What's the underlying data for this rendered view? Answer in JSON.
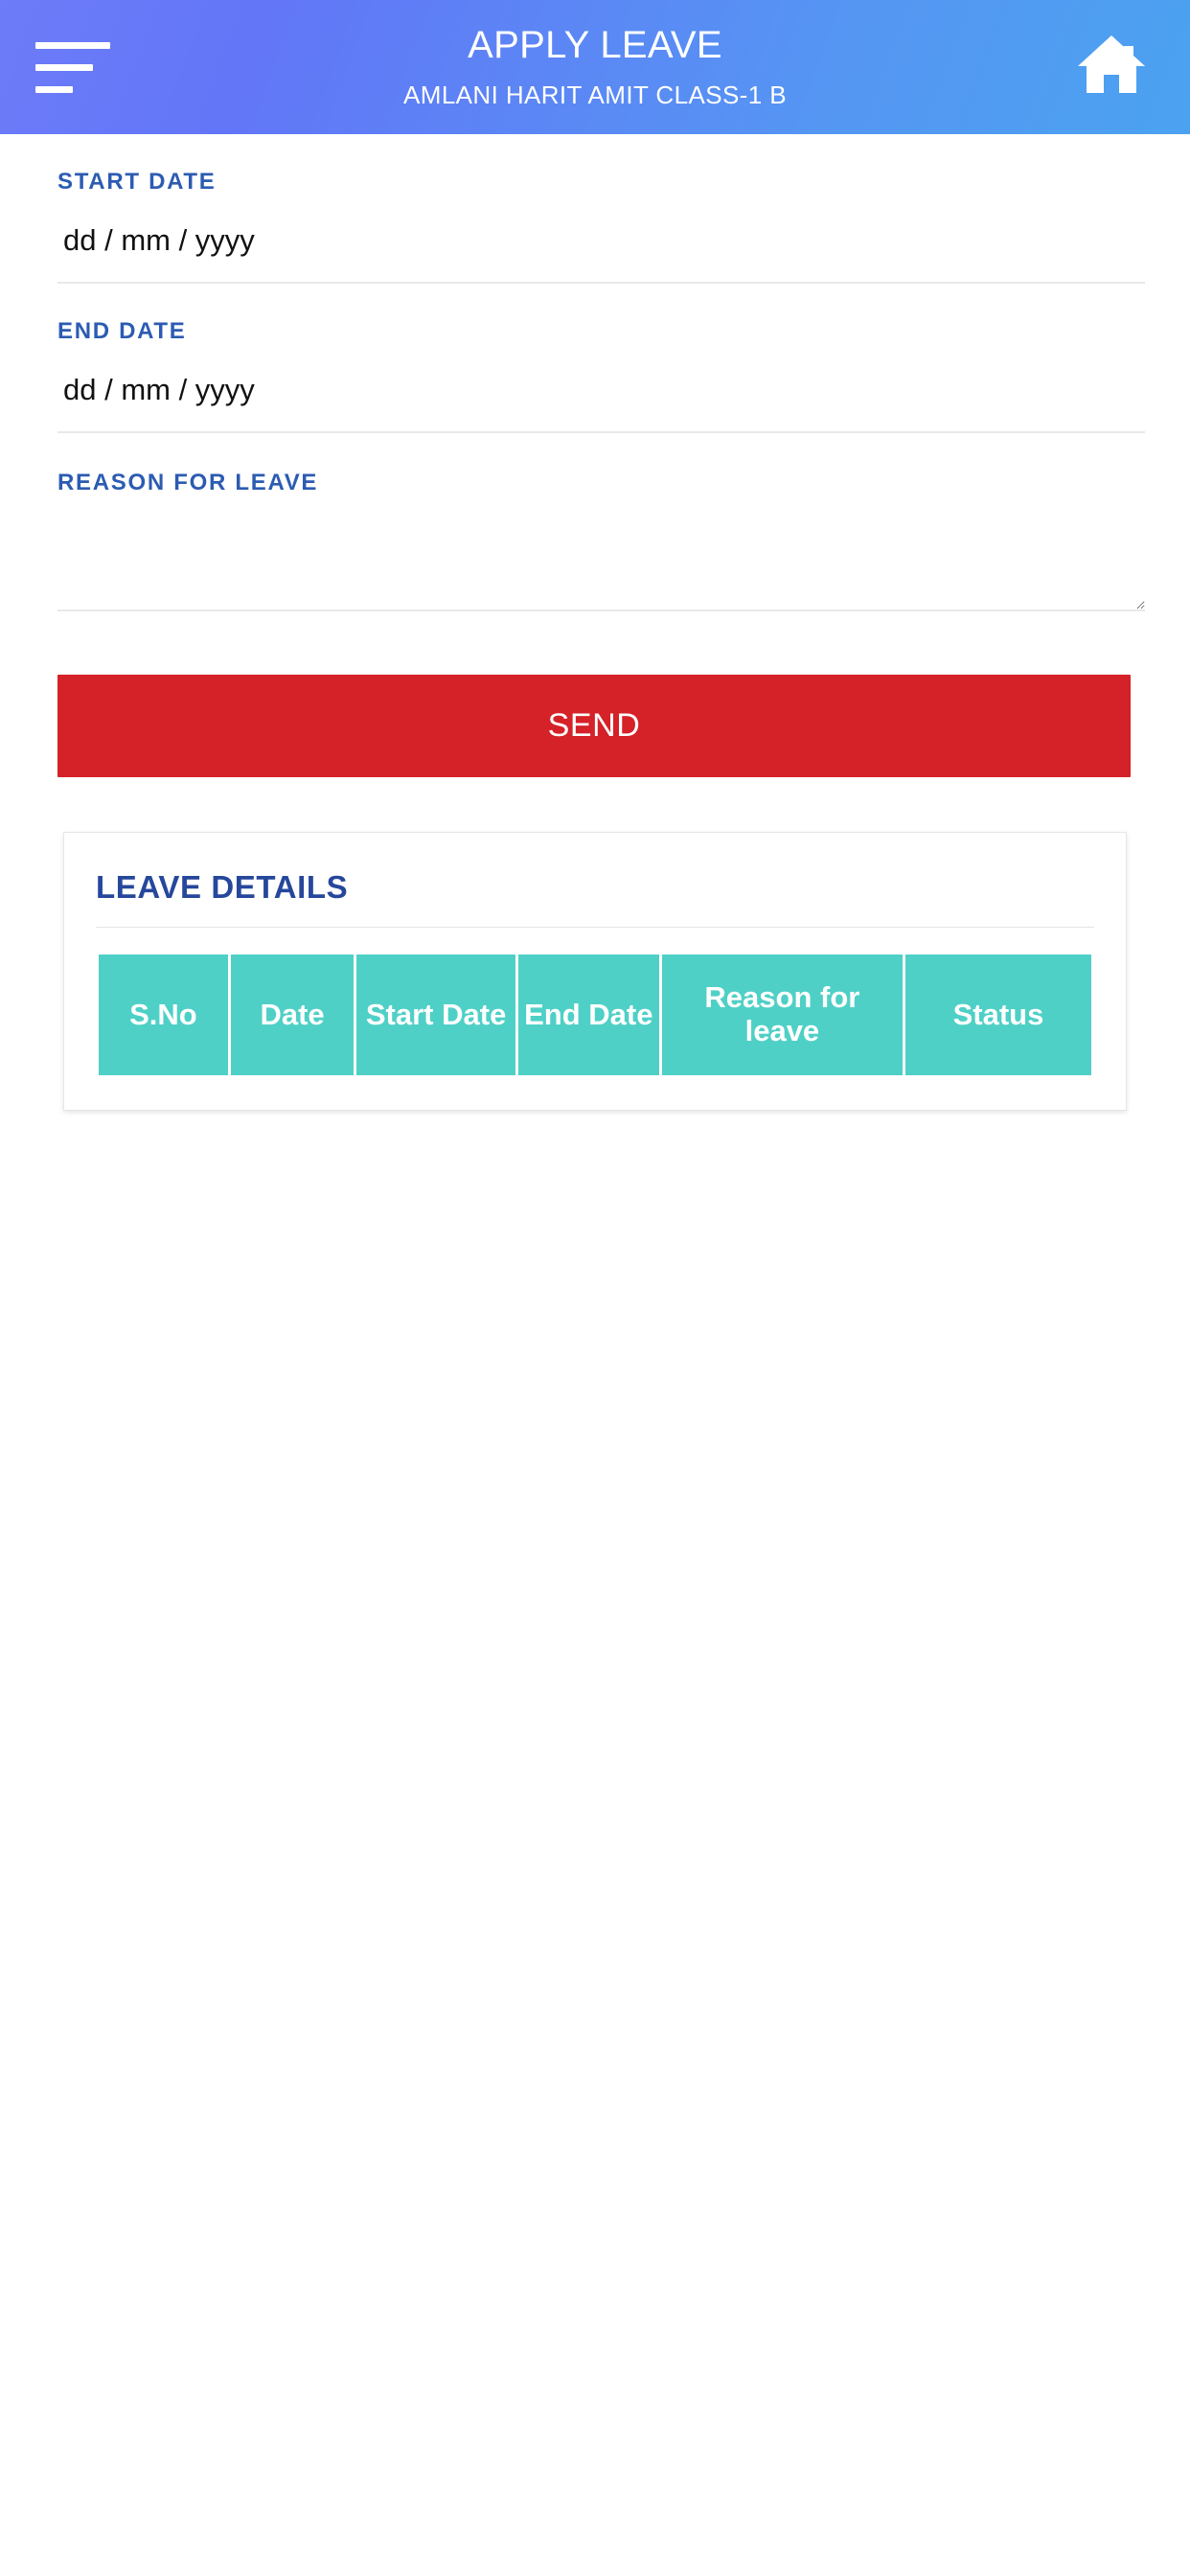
{
  "appbar": {
    "title": "APPLY LEAVE",
    "subtitle": "AMLANI HARIT AMIT CLASS-1 B",
    "menu_icon": "hamburger-menu-icon",
    "home_icon": "home-icon"
  },
  "form": {
    "start_date": {
      "label": "START DATE",
      "value": "",
      "placeholder": "dd / mm / yyyy"
    },
    "end_date": {
      "label": "END DATE",
      "value": "",
      "placeholder": "dd / mm / yyyy"
    },
    "reason": {
      "label": "REASON FOR LEAVE",
      "value": "",
      "placeholder": ""
    },
    "submit_label": "SEND"
  },
  "leave_details": {
    "title": "LEAVE DETAILS",
    "columns": [
      "S.No",
      "Date",
      "Start Date",
      "End Date",
      "Reason for leave",
      "Status"
    ],
    "rows": []
  },
  "colors": {
    "header_gradient_start": "#6d7cf8",
    "header_gradient_end": "#4ba2f0",
    "label_blue": "#2c5bb2",
    "title_blue": "#26479b",
    "send_red": "#d52128",
    "table_header_teal": "#4fd0c6",
    "page_background": "#ffffff"
  }
}
